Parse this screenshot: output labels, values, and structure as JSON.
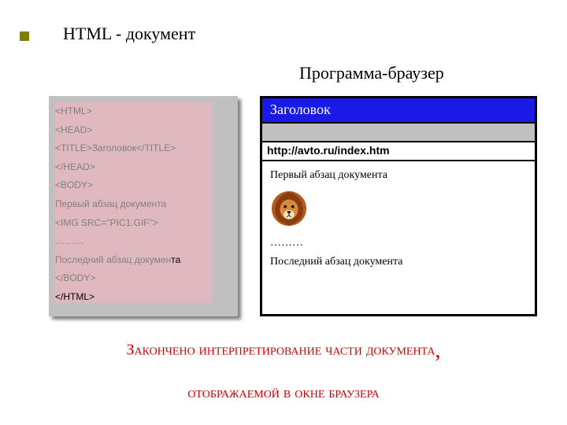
{
  "headings": {
    "left": "HTML - документ",
    "right": "Программа-браузер"
  },
  "code": {
    "l1": "<HTML>",
    "l2": "<HEAD>",
    "l3a": "<TITLE>",
    "l3b": "Заголовок",
    "l3c": "</TITLE>",
    "l4": "</HEAD>",
    "l5": "<BODY>",
    "l6": "Первый абзац документа",
    "l7": "<IMG SRC=\"PIC1.GIF\">",
    "l8": "………",
    "l9a": "Последний абзац докумен",
    "l9b": "та",
    "l10": "</BODY>",
    "l11": "</HTML>"
  },
  "browser": {
    "title": "Заголовок",
    "address": "http://avto.ru/index.htm",
    "content": {
      "p1": "Первый абзац документа",
      "dots": "………",
      "last": "Последний абзац документа"
    }
  },
  "caption": {
    "line1a": "Закончено интерпретирование части документа",
    "comma": ",",
    "line2": "отображаемой в окне браузера"
  }
}
